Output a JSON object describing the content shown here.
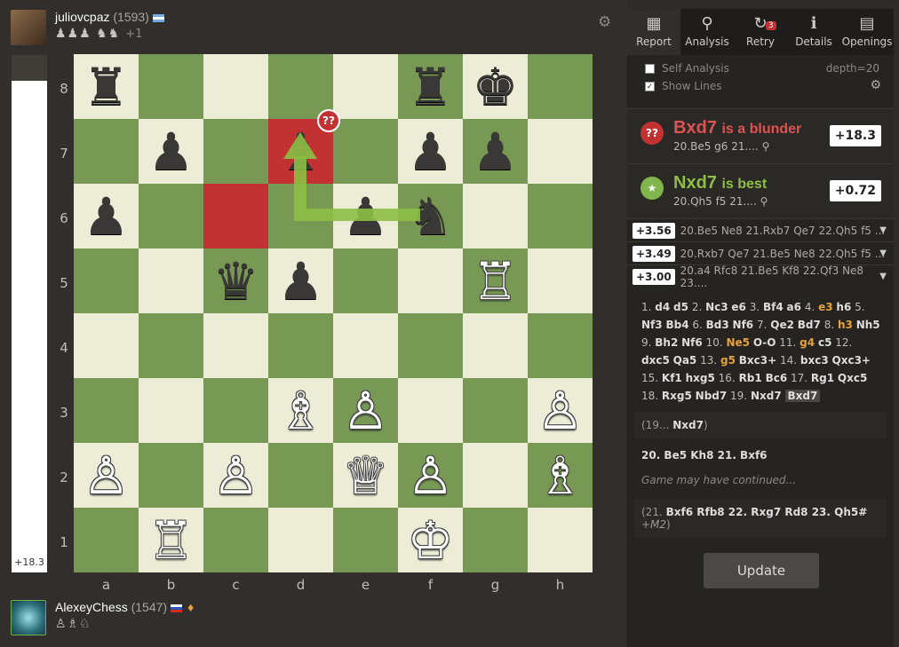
{
  "top_player": {
    "name": "juliovcpaz",
    "rating": "(1593)",
    "captured": "♟♟♟ ♞♞",
    "captured_more": "+1"
  },
  "bottom_player": {
    "name": "AlexeyChess",
    "rating": "(1547)",
    "captured": "♙♗♘"
  },
  "eval_bar": {
    "label": "+18.3",
    "white_fraction": 0.95
  },
  "board": {
    "ranks": [
      "8",
      "7",
      "6",
      "5",
      "4",
      "3",
      "2",
      "1"
    ],
    "files": [
      "a",
      "b",
      "c",
      "d",
      "e",
      "f",
      "g",
      "h"
    ],
    "rows": [
      [
        "♜",
        "",
        "",
        "",
        "",
        "♜",
        "♚",
        ""
      ],
      [
        "",
        "♟",
        "",
        "♝",
        "",
        "♟",
        "♟",
        ""
      ],
      [
        "♟",
        "",
        "",
        "",
        "♟",
        "♞",
        "",
        ""
      ],
      [
        "",
        "",
        "♛",
        "♟",
        "",
        "",
        "♖",
        ""
      ],
      [
        "",
        "",
        "",
        "",
        "",
        "",
        "",
        ""
      ],
      [
        "",
        "",
        "",
        "♗",
        "♙",
        "",
        "",
        "♙"
      ],
      [
        "♙",
        "",
        "♙",
        "",
        "♕",
        "♙",
        "",
        "♗"
      ],
      [
        "",
        "♖",
        "",
        "",
        "",
        "♔",
        "",
        ""
      ]
    ],
    "blunder_badge": "??"
  },
  "tabs": [
    {
      "label": "Report",
      "icon": "▦"
    },
    {
      "label": "Analysis",
      "icon": "⚲"
    },
    {
      "label": "Retry",
      "icon": "↻",
      "badge": "3"
    },
    {
      "label": "Details",
      "icon": "ℹ"
    },
    {
      "label": "Openings",
      "icon": "▤"
    }
  ],
  "options": {
    "self_analysis": "Self Analysis",
    "show_lines": "Show Lines",
    "depth": "depth=20"
  },
  "blunder": {
    "icon": "??",
    "move": "Bxd7",
    "text": "is a blunder",
    "line": "20.Be5 g6 21....",
    "score": "+18.3",
    "color": "#c33232"
  },
  "best": {
    "icon": "★",
    "move": "Nxd7",
    "text": "is best",
    "line": "20.Qh5 f5 21....",
    "score": "+0.72",
    "color": "#81b64c"
  },
  "engine_lines": [
    {
      "score": "+3.56",
      "line": "20.Be5 Ne8 21.Rxb7 Qe7 22.Qh5 f5 ..."
    },
    {
      "score": "+3.49",
      "line": "20.Rxb7 Qe7 21.Be5 Ne8 22.Qh5 f5 ..."
    },
    {
      "score": "+3.00",
      "line": "20.a4 Rfc8 21.Be5 Kf8 22.Qf3 Ne8 23...."
    }
  ],
  "variation": {
    "prefix": "(19...",
    "move": "Nxd7",
    ")": ")"
  },
  "continuation": "20. Be5 Kh8 21. Bxf6",
  "continued_label": "Game may have continued...",
  "alt_line": {
    "prefix": "(21.",
    "moves": "Bxf6 Rfb8 22. Rxg7 Rd8 23. Qh5#",
    "mate": "+M2",
    ")": ")"
  },
  "update_button": "Update"
}
